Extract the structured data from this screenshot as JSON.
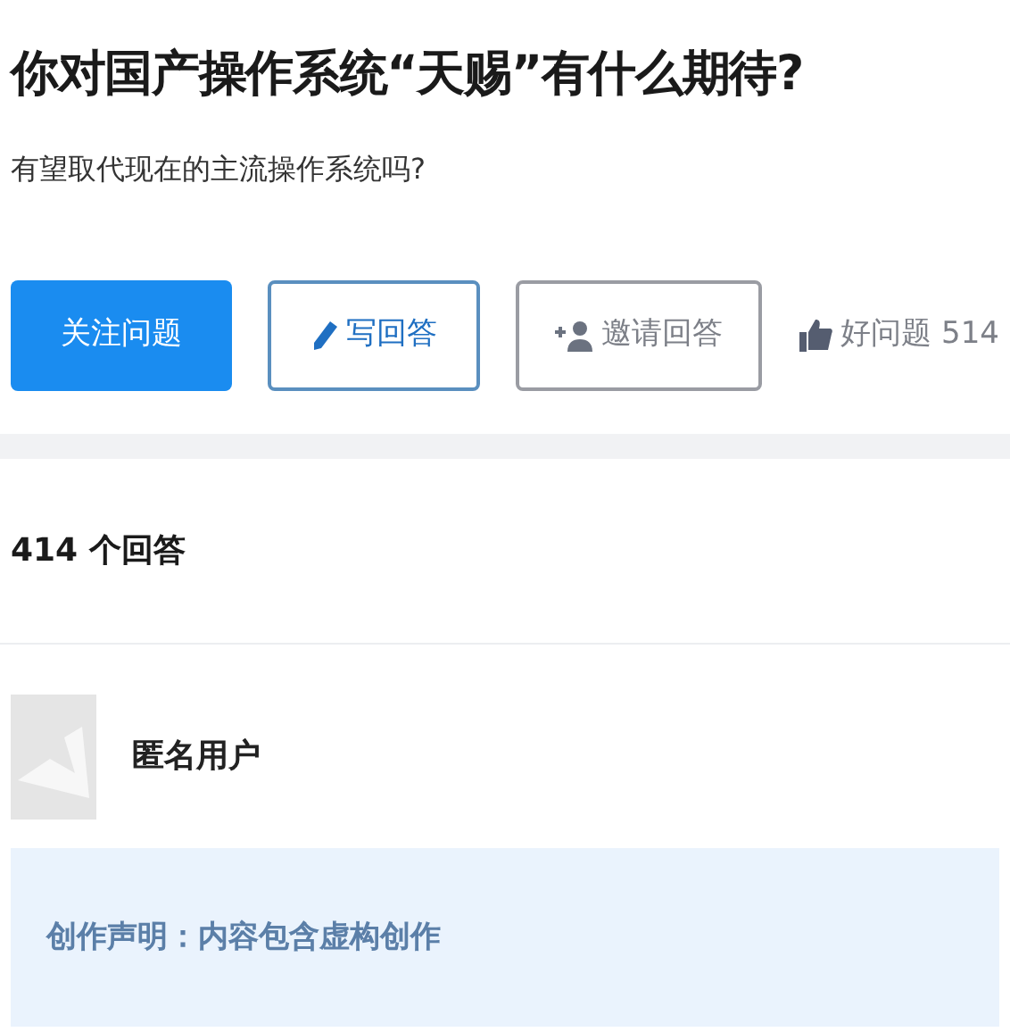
{
  "question": {
    "title": "你对国产操作系统“天赐”有什么期待?",
    "description": "有望取代现在的主流操作系统吗?"
  },
  "actions": [
    {
      "kind": "primary",
      "label": "关注问题"
    },
    {
      "kind": "outline",
      "label": "写回答"
    },
    {
      "kind": "plain",
      "label": "邀请回答"
    },
    {
      "kind": "text",
      "label": "好问题 514"
    }
  ],
  "answers": {
    "count": "414 个回答",
    "author": "匿名用户",
    "notice": "创作声明：内容包含虚构创作"
  }
}
